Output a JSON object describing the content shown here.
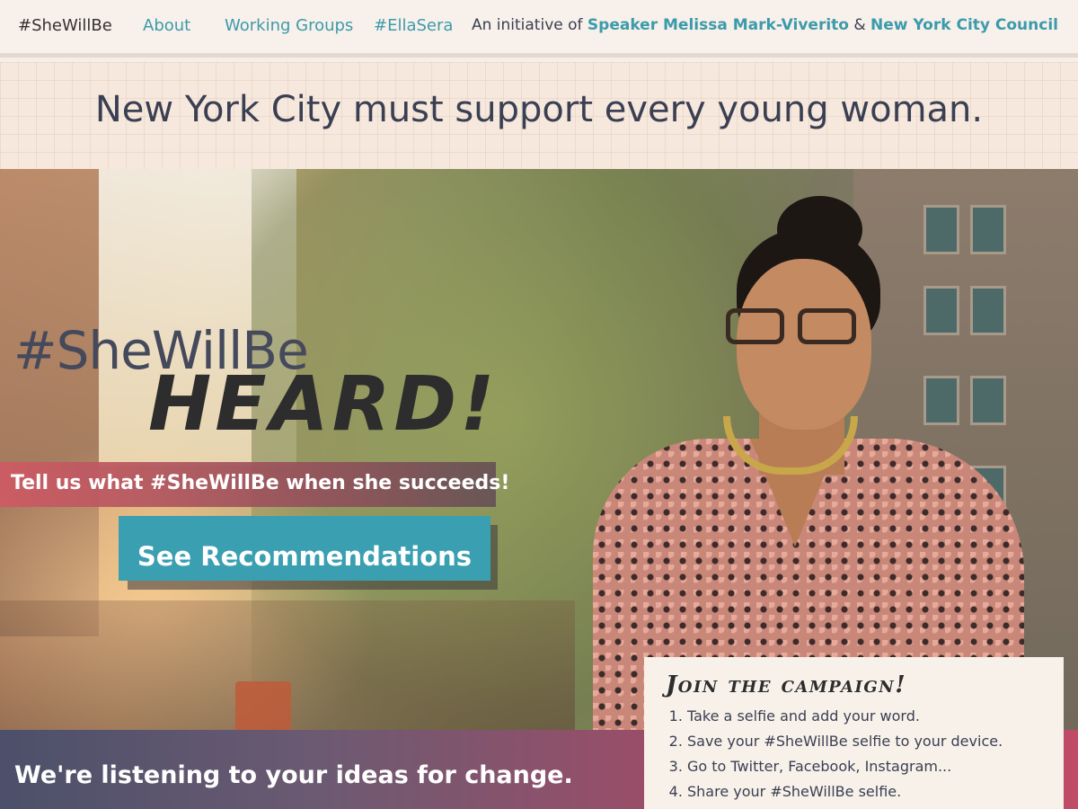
{
  "nav": {
    "brand": "#SheWillBe",
    "links": [
      "About",
      "Working Groups",
      "#EllaSera"
    ],
    "initiative_prefix": "An initiative of",
    "speaker": "Speaker Melissa Mark-Viverito",
    "amp": "&",
    "council": "New York City Council"
  },
  "tagline": "New York City must support every young woman.",
  "hero": {
    "hashtag": "#SheWillBe",
    "heard": "HEARD!",
    "prompt": "Tell us what #SheWillBe when she succeeds!",
    "cta": "See Recommendations"
  },
  "bottom": {
    "text": "We're listening to your ideas for change."
  },
  "join": {
    "title": "Join the campaign!",
    "steps": [
      "Take a selfie and add your word.",
      "Save your #SheWillBe selfie to your device.",
      "Go to Twitter, Facebook, Instagram...",
      "Share your #SheWillBe selfie."
    ]
  },
  "colors": {
    "accent": "#3a9fb1",
    "text": "#3a3f52",
    "band": "#f6e8dd",
    "promptStart": "#cf5a64"
  },
  "icons": []
}
